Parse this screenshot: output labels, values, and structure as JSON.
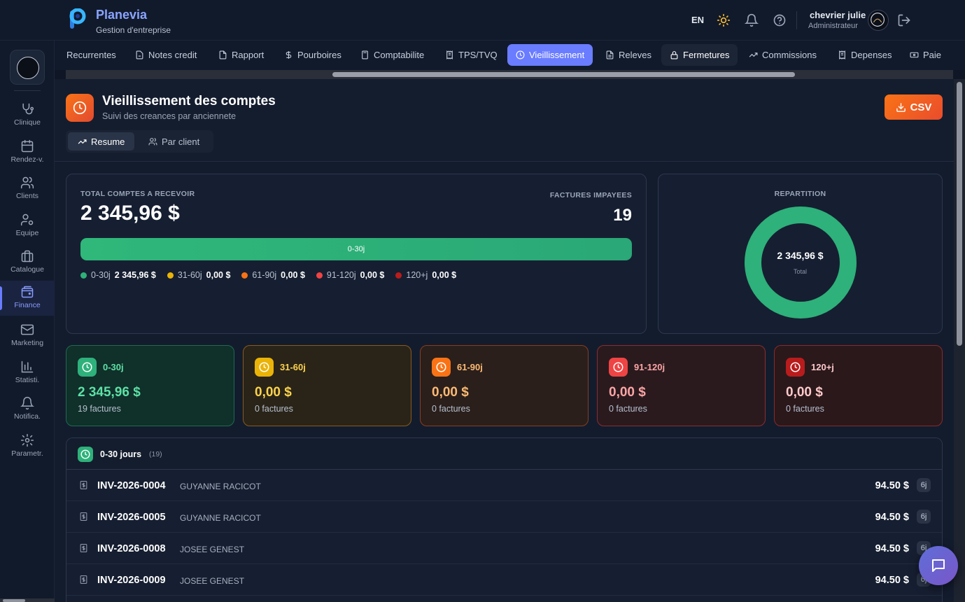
{
  "brand": {
    "name": "Planevia",
    "subtitle": "Gestion d'entreprise"
  },
  "header": {
    "lang": "EN",
    "user_name": "chevrier julie",
    "user_role": "Administrateur",
    "icons": [
      "sun-icon",
      "bell-icon",
      "help-icon",
      "logout-icon"
    ]
  },
  "sidebar": {
    "items": [
      {
        "label": "Clinique",
        "icon": "stethoscope-icon"
      },
      {
        "label": "Rendez-v.",
        "icon": "calendar-icon"
      },
      {
        "label": "Clients",
        "icon": "users-icon"
      },
      {
        "label": "Equipe",
        "icon": "team-settings-icon"
      },
      {
        "label": "Catalogue",
        "icon": "briefcase-icon"
      },
      {
        "label": "Finance",
        "icon": "wallet-icon",
        "active": true
      },
      {
        "label": "Marketing",
        "icon": "mail-icon"
      },
      {
        "label": "Statisti.",
        "icon": "bar-chart-icon"
      },
      {
        "label": "Notifica.",
        "icon": "bell-icon"
      },
      {
        "label": "Parametr.",
        "icon": "gear-icon"
      }
    ]
  },
  "tabs": [
    {
      "label": "Recurrentes",
      "icon": ""
    },
    {
      "label": "Notes credit",
      "icon": "file-minus-icon"
    },
    {
      "label": "Rapport",
      "icon": "file-icon"
    },
    {
      "label": "Pourboires",
      "icon": "dollar-icon"
    },
    {
      "label": "Comptabilite",
      "icon": "calculator-icon"
    },
    {
      "label": "TPS/TVQ",
      "icon": "receipt-icon"
    },
    {
      "label": "Vieillissement",
      "icon": "clock-icon",
      "active": true
    },
    {
      "label": "Releves",
      "icon": "file-text-icon"
    },
    {
      "label": "Fermetures",
      "icon": "lock-icon"
    },
    {
      "label": "Commissions",
      "icon": "trending-up-icon"
    },
    {
      "label": "Depenses",
      "icon": "receipt-icon"
    },
    {
      "label": "Paie",
      "icon": "banknote-icon"
    }
  ],
  "page": {
    "title": "Vieillissement des comptes",
    "subtitle": "Suivi des creances par anciennete",
    "csv_label": "CSV",
    "views": [
      "Resume",
      "Par client"
    ]
  },
  "summary": {
    "total_label": "TOTAL COMPTES A RECEVOIR",
    "total_value": "2 345,96 $",
    "unpaid_label": "FACTURES IMPAYEES",
    "unpaid_value": "19",
    "bar_label": "0-30j",
    "bar_fraction": 1.0,
    "legend": [
      {
        "name": "0-30j",
        "value": "2 345,96 $",
        "color": "#2eb17a"
      },
      {
        "name": "31-60j",
        "value": "0,00 $",
        "color": "#eab308"
      },
      {
        "name": "61-90j",
        "value": "0,00 $",
        "color": "#f97316"
      },
      {
        "name": "91-120j",
        "value": "0,00 $",
        "color": "#ef4444"
      },
      {
        "name": "120+j",
        "value": "0,00 $",
        "color": "#b91c1c"
      }
    ]
  },
  "repartition": {
    "label": "REPARTITION",
    "center_value": "2 345,96 $",
    "center_label": "Total"
  },
  "buckets": [
    {
      "name": "0-30j",
      "amount": "2 345,96 $",
      "count": "19 factures",
      "accent": "#2eb17a",
      "text": "#5ee0a6",
      "bg": "#10302a",
      "border": "#1f6b4f"
    },
    {
      "name": "31-60j",
      "amount": "0,00 $",
      "count": "0 factures",
      "accent": "#eab308",
      "text": "#fcd34d",
      "bg": "#2a2418",
      "border": "#8a5a1c"
    },
    {
      "name": "61-90j",
      "amount": "0,00 $",
      "count": "0 factures",
      "accent": "#f97316",
      "text": "#fdba74",
      "bg": "#2a1f1b",
      "border": "#8a3d20"
    },
    {
      "name": "91-120j",
      "amount": "0,00 $",
      "count": "0 factures",
      "accent": "#ef4444",
      "text": "#fca5a5",
      "bg": "#2a1a1e",
      "border": "#8a2d30"
    },
    {
      "name": "120+j",
      "amount": "0,00 $",
      "count": "0 factures",
      "accent": "#b91c1c",
      "text": "#fecaca",
      "bg": "#2b181b",
      "border": "#8a2a2a"
    }
  ],
  "invoice_list": {
    "title": "0-30 jours",
    "count": "(19)",
    "rows": [
      {
        "number": "INV-2026-0004",
        "customer": "GUYANNE RACICOT",
        "amount": "94.50 $",
        "days": "6j"
      },
      {
        "number": "INV-2026-0005",
        "customer": "GUYANNE RACICOT",
        "amount": "94.50 $",
        "days": "6j"
      },
      {
        "number": "INV-2026-0008",
        "customer": "JOSEE GENEST",
        "amount": "94.50 $",
        "days": "6j"
      },
      {
        "number": "INV-2026-0009",
        "customer": "JOSEE GENEST",
        "amount": "94.50 $",
        "days": "6j"
      }
    ]
  }
}
